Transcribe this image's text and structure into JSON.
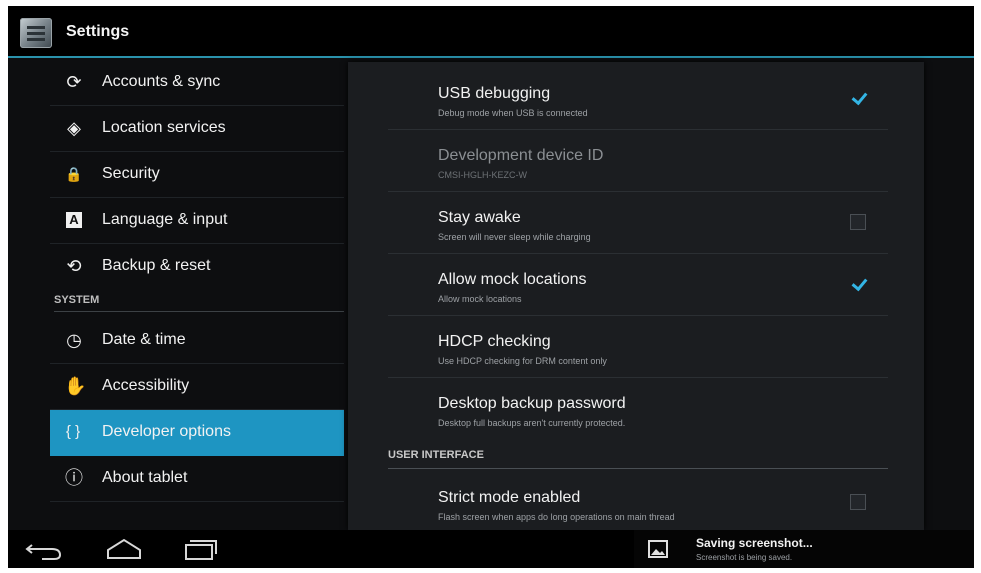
{
  "app_bar": {
    "title": "Settings"
  },
  "headers": {
    "items": [
      {
        "label": "Accounts & sync",
        "icon": "sync-icon",
        "glyph": "⟳"
      },
      {
        "label": "Location services",
        "icon": "location-icon",
        "glyph": "◈"
      },
      {
        "label": "Security",
        "icon": "lock-icon",
        "glyph": "🔒"
      },
      {
        "label": "Language & input",
        "icon": "keyboard-letter-icon",
        "glyph": "A"
      },
      {
        "label": "Backup & reset",
        "icon": "restore-icon",
        "glyph": "⟲"
      }
    ],
    "system_section": "SYSTEM",
    "system_items": [
      {
        "label": "Date & time",
        "icon": "clock-icon",
        "glyph": "◷"
      },
      {
        "label": "Accessibility",
        "icon": "hand-icon",
        "glyph": "✋"
      },
      {
        "label": "Developer options",
        "icon": "braces-icon",
        "glyph": "{ }"
      },
      {
        "label": "About tablet",
        "icon": "info-icon",
        "glyph": "ⓘ"
      }
    ],
    "active": "Developer options"
  },
  "developer_options": {
    "prefs": [
      {
        "title": "USB debugging",
        "summary": "Debug mode when USB is connected",
        "checked": true
      },
      {
        "title": "Development device ID",
        "summary": "CMSI-HGLH-KEZC-W",
        "disabled": true
      },
      {
        "title": "Stay awake",
        "summary": "Screen will never sleep while charging",
        "checked": false
      },
      {
        "title": "Allow mock locations",
        "summary": "Allow mock locations",
        "checked": true
      },
      {
        "title": "HDCP checking",
        "summary": "Use HDCP checking for DRM content only"
      },
      {
        "title": "Desktop backup password",
        "summary": "Desktop full backups aren't currently protected."
      }
    ],
    "category": "USER INTERFACE",
    "ui_prefs": [
      {
        "title": "Strict mode enabled",
        "summary": "Flash screen when apps do long operations on main thread",
        "checked": false
      }
    ]
  },
  "nav_bar": {
    "icons": [
      "back-icon",
      "home-icon",
      "recent-apps-icon"
    ]
  },
  "notification": {
    "title": "Saving screenshot...",
    "text": "Screenshot is being saved."
  },
  "colors": {
    "accent": "#33b5e5",
    "selected_header": "#1e95c2",
    "action_bar_line": "#2a92ac"
  }
}
